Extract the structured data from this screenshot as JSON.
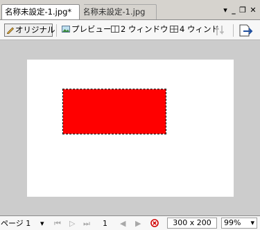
{
  "tabs": {
    "active_label": "名称未設定-1.jpg*",
    "inactive_label": "名称未設定-1.jpg"
  },
  "window_controls": {
    "menu": "▾",
    "minimize": "_",
    "restore": "❐",
    "close": "✕"
  },
  "toolbar": {
    "original": "オリジナル",
    "preview": "プレビュー",
    "two_window": "2 ウィンドウ",
    "four_window": "4 ウィンド"
  },
  "status": {
    "page_select": "ページ 1",
    "page_number": "1",
    "dimensions": "300 x 200",
    "zoom": "99%"
  },
  "colors": {
    "shape_fill": "#ff0000",
    "canvas_bg": "#ffffff",
    "workspace_bg": "#cccccc"
  }
}
